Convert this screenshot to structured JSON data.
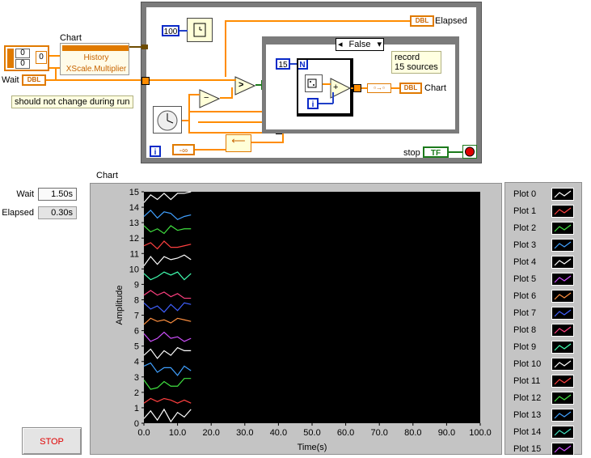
{
  "diagram": {
    "chart_label": "Chart",
    "history_label": "History",
    "xscale_label": "XScale.Multiplier",
    "wait_label": "Wait",
    "dbl_text": "DBL",
    "array_values": [
      "0",
      "0"
    ],
    "index_value": "0",
    "note_text": "should not change during run",
    "wait_ms": "100",
    "elapsed_label": "Elapsed",
    "case_selector": "False",
    "record_note": [
      "record",
      "15 sources"
    ],
    "count_value": "15",
    "n_label": "N",
    "i_label": "i",
    "chart_indicator_label": "Chart",
    "neg_inf": "-∞",
    "stop_label": "stop",
    "tf_text": "TF",
    "gt_symbol": ">",
    "minus_symbol": "−",
    "plus_symbol": "+",
    "question": "?"
  },
  "panel": {
    "chart_title": "Chart",
    "wait_label": "Wait",
    "wait_value": "1.50s",
    "elapsed_label": "Elapsed",
    "elapsed_value": "0.30s",
    "stop_button": "STOP"
  },
  "legend": [
    {
      "name": "Plot 0",
      "color": "#ffffff"
    },
    {
      "name": "Plot 1",
      "color": "#ff4040"
    },
    {
      "name": "Plot 2",
      "color": "#40e040"
    },
    {
      "name": "Plot 3",
      "color": "#40a0ff"
    },
    {
      "name": "Plot 4",
      "color": "#ffffff"
    },
    {
      "name": "Plot 5",
      "color": "#d050ff"
    },
    {
      "name": "Plot 6",
      "color": "#ff9040"
    },
    {
      "name": "Plot 7",
      "color": "#4060ff"
    },
    {
      "name": "Plot 8",
      "color": "#ff4080"
    },
    {
      "name": "Plot 9",
      "color": "#40ffb0"
    },
    {
      "name": "Plot 10",
      "color": "#ffffff"
    },
    {
      "name": "Plot 11",
      "color": "#ff4040"
    },
    {
      "name": "Plot 12",
      "color": "#40e040"
    },
    {
      "name": "Plot 13",
      "color": "#40a0ff"
    },
    {
      "name": "Plot 14",
      "color": "#40e0c0"
    },
    {
      "name": "Plot 15",
      "color": "#d050ff"
    }
  ],
  "chart_data": {
    "type": "line",
    "title": "Chart",
    "xlabel": "Time(s)",
    "ylabel": "Amplitude",
    "xlim": [
      0,
      100
    ],
    "ylim": [
      0,
      15
    ],
    "x_ticks": [
      "0.0",
      "10.0",
      "20.0",
      "30.0",
      "40.0",
      "50.0",
      "60.0",
      "70.0",
      "80.0",
      "90.0",
      "100.0"
    ],
    "y_ticks": [
      "0",
      "1",
      "2",
      "3",
      "4",
      "5",
      "6",
      "7",
      "8",
      "9",
      "10",
      "11",
      "12",
      "13",
      "14",
      "15"
    ],
    "x": [
      0,
      2,
      4,
      6,
      8,
      10,
      12,
      14
    ],
    "series": [
      {
        "name": "Plot 0",
        "color": "#ffffff",
        "values": [
          0.3,
          0.8,
          0.2,
          0.9,
          0.1,
          0.7,
          0.4,
          0.9
        ]
      },
      {
        "name": "Plot 1",
        "color": "#ff4040",
        "values": [
          1.3,
          1.6,
          1.4,
          1.6,
          1.5,
          1.3,
          1.5,
          1.3
        ]
      },
      {
        "name": "Plot 2",
        "color": "#40e040",
        "values": [
          2.8,
          2.2,
          2.3,
          2.7,
          2.4,
          2.4,
          2.9,
          2.9
        ]
      },
      {
        "name": "Plot 3",
        "color": "#40a0ff",
        "values": [
          3.7,
          3.9,
          3.3,
          3.6,
          3.6,
          3.1,
          3.7,
          3.4
        ]
      },
      {
        "name": "Plot 4",
        "color": "#ffffff",
        "values": [
          4.4,
          4.8,
          4.2,
          4.7,
          4.4,
          4.9,
          4.7,
          4.7
        ]
      },
      {
        "name": "Plot 5",
        "color": "#d050ff",
        "values": [
          5.8,
          5.3,
          5.5,
          5.9,
          5.5,
          5.6,
          5.3,
          5.5
        ]
      },
      {
        "name": "Plot 6",
        "color": "#ff9040",
        "values": [
          6.4,
          6.8,
          6.6,
          6.7,
          6.5,
          6.8,
          6.7,
          6.6
        ]
      },
      {
        "name": "Plot 7",
        "color": "#4060ff",
        "values": [
          7.8,
          7.4,
          7.6,
          7.2,
          7.7,
          7.3,
          7.8,
          7.7
        ]
      },
      {
        "name": "Plot 8",
        "color": "#ff4080",
        "values": [
          8.3,
          8.6,
          8.3,
          8.5,
          8.2,
          8.4,
          8.1,
          8.1
        ]
      },
      {
        "name": "Plot 9",
        "color": "#40ffb0",
        "values": [
          9.7,
          9.3,
          9.5,
          9.8,
          9.6,
          9.8,
          9.3,
          9.7
        ]
      },
      {
        "name": "Plot 10",
        "color": "#ffffff",
        "values": [
          10.2,
          10.8,
          10.3,
          10.8,
          10.6,
          10.7,
          10.9,
          10.6
        ]
      },
      {
        "name": "Plot 11",
        "color": "#ff4040",
        "values": [
          11.5,
          11.7,
          11.3,
          11.8,
          11.4,
          11.4,
          11.5,
          11.6
        ]
      },
      {
        "name": "Plot 12",
        "color": "#40e040",
        "values": [
          12.8,
          12.4,
          12.6,
          12.3,
          12.8,
          12.5,
          12.6,
          12.6
        ]
      },
      {
        "name": "Plot 13",
        "color": "#40a0ff",
        "values": [
          13.4,
          13.8,
          13.3,
          13.7,
          13.6,
          13.2,
          13.4,
          13.5
        ]
      },
      {
        "name": "Plot 14",
        "color": "#ffffff",
        "values": [
          14.3,
          14.8,
          14.5,
          14.9,
          14.5,
          14.9,
          14.9,
          15.0
        ]
      },
      {
        "name": "Plot 15",
        "color": "#d050ff",
        "values": []
      }
    ]
  }
}
